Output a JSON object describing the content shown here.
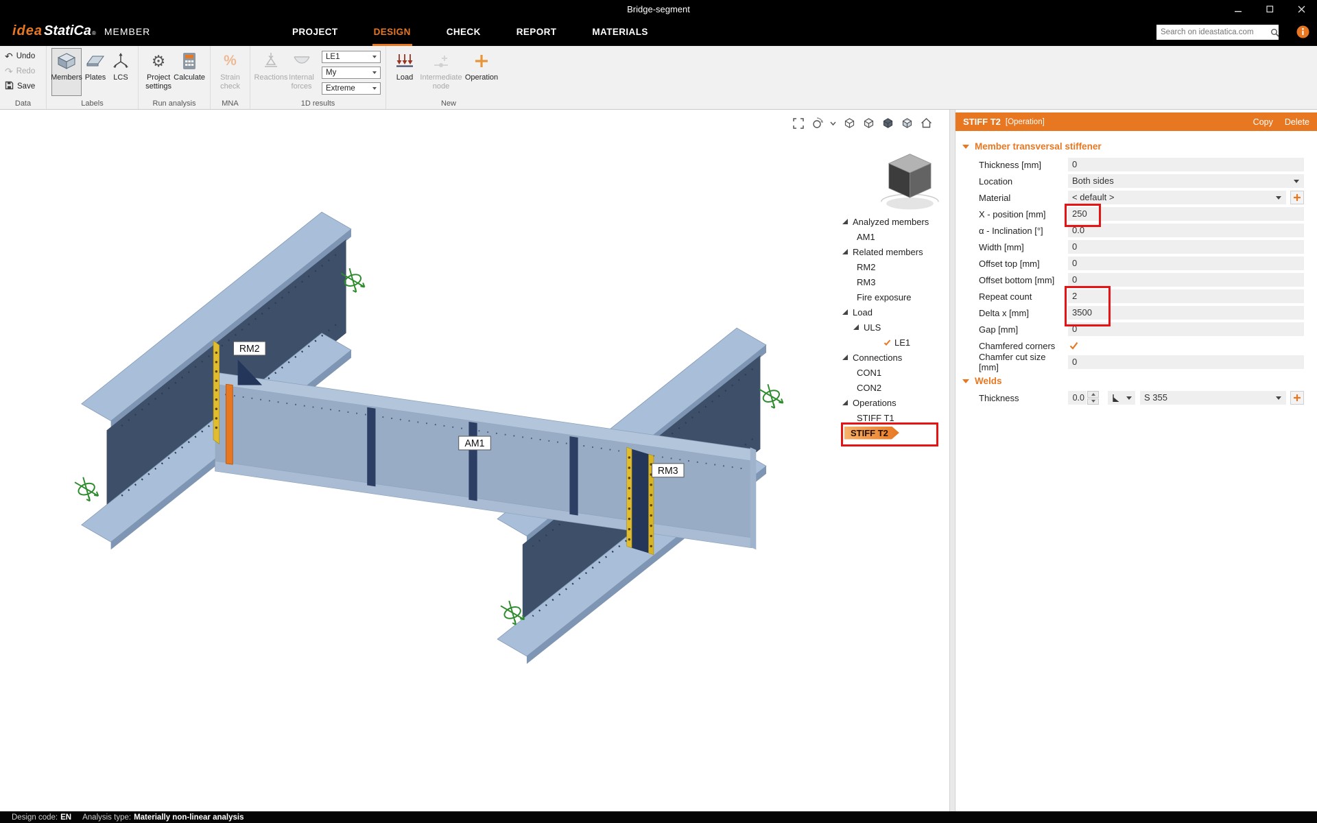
{
  "colors": {
    "accent": "#e87722",
    "annotation": "#e51313"
  },
  "titlebar": {
    "title": "Bridge-segment"
  },
  "menubar": {
    "logo": {
      "idea": "idea",
      "statica": "StatiCa",
      "reg": "®",
      "app": "MEMBER"
    },
    "tabs": [
      {
        "label": "PROJECT"
      },
      {
        "label": "DESIGN",
        "active": true
      },
      {
        "label": "CHECK"
      },
      {
        "label": "REPORT"
      },
      {
        "label": "MATERIALS"
      }
    ],
    "search": {
      "placeholder": "Search on ideastatica.com"
    }
  },
  "icons": {
    "undo": "↶",
    "redo": "↷",
    "gear": "⚙",
    "percent": "%"
  },
  "ribbon": {
    "data_group": {
      "label": "Data",
      "undo": "Undo",
      "redo": "Redo",
      "save": "Save"
    },
    "labels_group": {
      "label": "Labels",
      "members": "Members",
      "plates": "Plates",
      "lcs": "LCS"
    },
    "run_group": {
      "label": "Run analysis",
      "project_settings": "Project settings",
      "calculate": "Calculate"
    },
    "mna_group": {
      "label": "MNA",
      "strain_check": "Strain check"
    },
    "results_group": {
      "label": "1D results",
      "reactions": "Reactions",
      "internal_forces": "Internal forces",
      "combos": [
        "LE1",
        "My",
        "Extreme"
      ]
    },
    "new_group": {
      "label": "New",
      "load": "Load",
      "intermediate_node": "Intermediate node",
      "operation": "Operation"
    }
  },
  "viewport": {
    "labels": {
      "rm2": "RM2",
      "am1": "AM1",
      "rm3": "RM3"
    }
  },
  "tree": {
    "items": [
      {
        "label": "Analyzed members"
      },
      {
        "label": "AM1"
      },
      {
        "label": "Related members"
      },
      {
        "label": "RM2"
      },
      {
        "label": "RM3"
      },
      {
        "label": "Fire exposure"
      },
      {
        "label": "Load"
      },
      {
        "label": "ULS"
      },
      {
        "label": "LE1"
      },
      {
        "label": "Connections"
      },
      {
        "label": "CON1"
      },
      {
        "label": "CON2"
      },
      {
        "label": "Operations"
      },
      {
        "label": "STIFF T1"
      },
      {
        "label": "STIFF T2",
        "selected": true
      }
    ]
  },
  "properties": {
    "header": {
      "title": "STIFF T2",
      "subtitle": "[Operation]",
      "copy": "Copy",
      "delete": "Delete"
    },
    "section1": "Member transversal stiffener",
    "rows": [
      {
        "label": "Thickness [mm]",
        "value": "0",
        "type": "field"
      },
      {
        "label": "Location",
        "value": "Both sides",
        "type": "dropdown"
      },
      {
        "label": "Material",
        "value": "< default >",
        "type": "dropdown-plus"
      },
      {
        "label": "X - position [mm]",
        "value": "250",
        "type": "field",
        "annotated": true
      },
      {
        "label": "α - Inclination [°]",
        "value": "0.0",
        "type": "field"
      },
      {
        "label": "Width [mm]",
        "value": "0",
        "type": "field"
      },
      {
        "label": "Offset top [mm]",
        "value": "0",
        "type": "field"
      },
      {
        "label": "Offset bottom [mm]",
        "value": "0",
        "type": "field"
      },
      {
        "label": "Repeat count",
        "value": "2",
        "type": "field",
        "annotated": true
      },
      {
        "label": "Delta x [mm]",
        "value": "3500",
        "type": "field",
        "annotated": true
      },
      {
        "label": "Gap [mm]",
        "value": "0",
        "type": "field"
      },
      {
        "label": "Chamfered corners",
        "value": "",
        "type": "check",
        "checked": true
      },
      {
        "label": "Chamfer cut size [mm]",
        "value": "0",
        "type": "field"
      }
    ],
    "section2": "Welds",
    "welds": {
      "label": "Thickness",
      "value": "0.0",
      "material": "S 355"
    }
  },
  "statusbar": {
    "code_label": "Design code:",
    "code_value": "EN",
    "type_label": "Analysis type:",
    "type_value": "Materially non-linear analysis"
  }
}
